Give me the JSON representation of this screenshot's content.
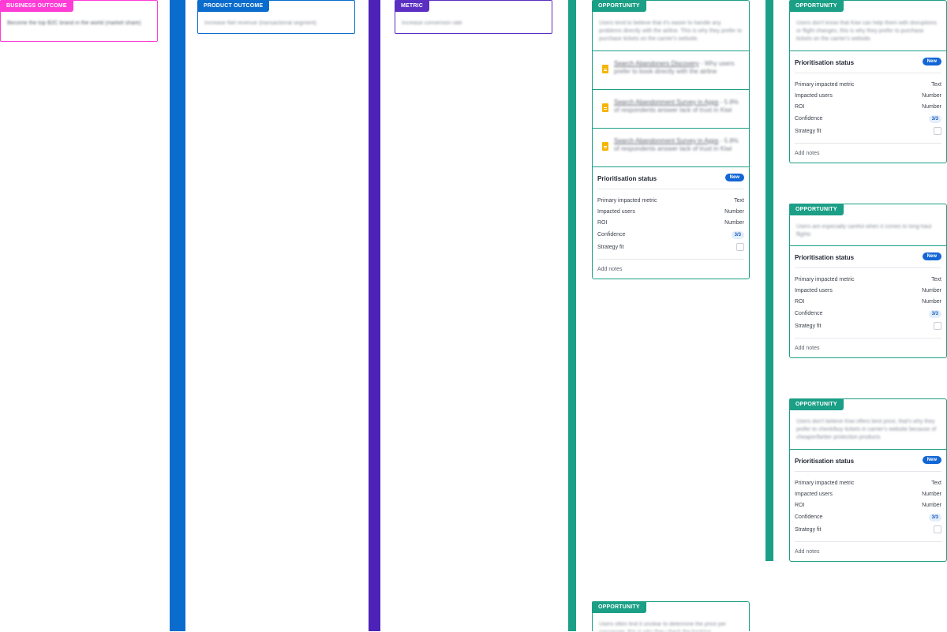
{
  "outcome": {
    "tag": "Business Outcome",
    "text": "Become the top B2C brand in the world (market share)",
    "color": "#ff3cd6"
  },
  "product": {
    "tag": "Product Outcome",
    "text": "Increase Net revenue (transactional segment)",
    "color": "#0a6ccc"
  },
  "metric": {
    "tag": "Metric",
    "text": "Increase conversion rate",
    "color": "#5a2fc2"
  },
  "colors": {
    "bar_blue": "#0a6ccc",
    "bar_purple": "#4d22b8",
    "bar_green": "#1b9f86",
    "teal": "#1b9f86"
  },
  "prio_labels": {
    "title": "Prioritisation status",
    "badge": "New",
    "metric_label": "Primary impacted metric",
    "metric_val": "Text",
    "users_label": "Impacted users",
    "users_val": "Number",
    "roi_label": "ROI",
    "roi_val": "Number",
    "confidence_label": "Confidence",
    "confidence_val": "3/3",
    "strategy_label": "Strategy fit",
    "notes": "Add notes"
  },
  "opp1": {
    "tag": "Opportunity",
    "text": "Users tend to believe that it's easier to handle any problems directly with the airline. This is why they prefer to purchase tickets on the carrier's website.",
    "evidence": [
      {
        "link": "Search Abandoners Discovery",
        "rest": " - Why users prefer to book directly with the airline"
      },
      {
        "link": "Search Abandonment Survey in Apps",
        "rest": " - 5.8% of respondents answer lack of trust in Kiwi"
      },
      {
        "link": "Search Abandonment Survey in Apps",
        "rest": " - 5.8% of respondents answer lack of trust in Kiwi"
      }
    ]
  },
  "opp2": {
    "tag": "Opportunity",
    "text": "Users don't know that Kiwi can help them with disruptions or flight changes, this is why they prefer to purchase tickets on the carrier's website."
  },
  "opp3": {
    "tag": "Opportunity",
    "text": "Users are especially careful when it comes to long-haul flights"
  },
  "opp4": {
    "tag": "Opportunity",
    "text": "Users don't believe Kiwi offers best price, that's why they prefer to check/buy tickets in carrier's website because of cheaper/better protection products"
  },
  "opp5": {
    "tag": "Opportunity",
    "text": "Users often find it unclear to determine the price per passenger, this is why they check the booking..."
  }
}
